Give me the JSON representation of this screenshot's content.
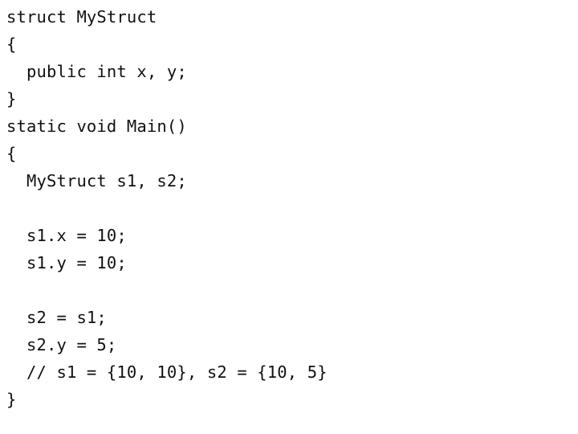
{
  "slide": {
    "background_color": "#ffffff",
    "text_color": "#111111",
    "language": "csharp"
  },
  "code": {
    "lines": [
      {
        "n": 1,
        "text": "struct MyStruct",
        "indent": 0,
        "blank": false
      },
      {
        "n": 2,
        "text": "{",
        "indent": 0,
        "blank": false
      },
      {
        "n": 3,
        "text": "  public int x, y;",
        "indent": 2,
        "blank": false
      },
      {
        "n": 4,
        "text": "}",
        "indent": 0,
        "blank": false
      },
      {
        "n": 5,
        "text": "static void Main()",
        "indent": 0,
        "blank": false
      },
      {
        "n": 6,
        "text": "{",
        "indent": 0,
        "blank": false
      },
      {
        "n": 7,
        "text": "  MyStruct s1, s2;",
        "indent": 2,
        "blank": false
      },
      {
        "n": 8,
        "text": "",
        "indent": 0,
        "blank": true
      },
      {
        "n": 9,
        "text": "  s1.x = 10;",
        "indent": 2,
        "blank": false
      },
      {
        "n": 10,
        "text": "  s1.y = 10;",
        "indent": 2,
        "blank": false
      },
      {
        "n": 11,
        "text": "",
        "indent": 0,
        "blank": true
      },
      {
        "n": 12,
        "text": "  s2 = s1;",
        "indent": 2,
        "blank": false
      },
      {
        "n": 13,
        "text": "  s2.y = 5;",
        "indent": 2,
        "blank": false
      },
      {
        "n": 14,
        "text": "  // s1 = {10, 10}, s2 = {10, 5}",
        "indent": 2,
        "blank": false
      },
      {
        "n": 15,
        "text": "}",
        "indent": 0,
        "blank": false
      }
    ]
  }
}
